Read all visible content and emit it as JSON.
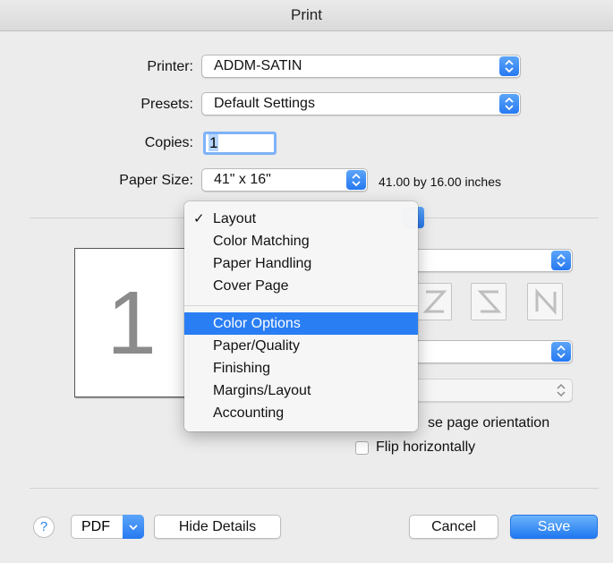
{
  "window": {
    "title": "Print"
  },
  "printer": {
    "label": "Printer:",
    "value": "ADDM-SATIN"
  },
  "presets": {
    "label": "Presets:",
    "value": "Default Settings"
  },
  "copies": {
    "label": "Copies:",
    "value": "1"
  },
  "paper_size": {
    "label": "Paper Size:",
    "value": "41\" x 16\"",
    "dimensions": "41.00 by 16.00 inches"
  },
  "preview": {
    "page_number": "1"
  },
  "menu": {
    "items_group1": [
      {
        "label": "Layout",
        "checked": true
      },
      {
        "label": "Color Matching"
      },
      {
        "label": "Paper Handling"
      },
      {
        "label": "Cover Page"
      }
    ],
    "items_group2": [
      {
        "label": "Color Options",
        "highlighted": true
      },
      {
        "label": "Paper/Quality"
      },
      {
        "label": "Finishing"
      },
      {
        "label": "Margins/Layout"
      },
      {
        "label": "Accounting"
      }
    ],
    "check_glyph": "✓"
  },
  "options": {
    "reverse_orientation_partial": "se page orientation",
    "flip_horizontally": "Flip horizontally"
  },
  "footer": {
    "help_glyph": "?",
    "pdf_label": "PDF",
    "hide_details_label": "Hide Details",
    "cancel_label": "Cancel",
    "save_label": "Save"
  },
  "colors": {
    "accent": "#2a7ef3",
    "background": "#ececec"
  }
}
